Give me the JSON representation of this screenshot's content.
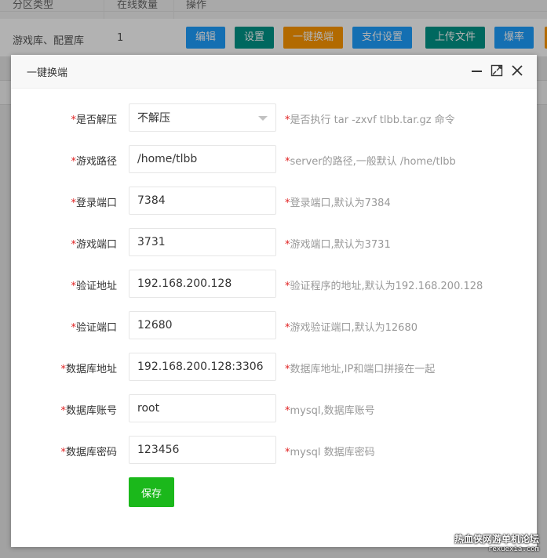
{
  "background_table": {
    "headers": [
      "分区类型",
      "在线数量",
      "操作"
    ],
    "row": {
      "type": "游戏库、配置库",
      "online": "1",
      "actions": [
        {
          "label": "编辑",
          "color": "#1e9fff"
        },
        {
          "label": "设置",
          "color": "#009688"
        },
        {
          "label": "一键换端",
          "color": "#ff9800"
        },
        {
          "label": "支付设置",
          "color": "#1e9fff"
        },
        {
          "label": "上传文件",
          "color": "#009688"
        },
        {
          "label": "爆率",
          "color": "#1e9fff"
        }
      ]
    }
  },
  "modal": {
    "title": "一键换端",
    "controls": [
      "minimize-icon",
      "maximize-icon",
      "close-icon"
    ],
    "fields": [
      {
        "label": "是否解压",
        "type": "select",
        "value": "不解压",
        "hint": "是否执行 tar -zxvf tlbb.tar.gz 命令"
      },
      {
        "label": "游戏路径",
        "type": "text",
        "value": "/home/tlbb",
        "hint": "server的路径,一般默认 /home/tlbb"
      },
      {
        "label": "登录端口",
        "type": "text",
        "value": "7384",
        "hint": "登录端口,默认为7384"
      },
      {
        "label": "游戏端口",
        "type": "text",
        "value": "3731",
        "hint": "游戏端口,默认为3731"
      },
      {
        "label": "验证地址",
        "type": "text",
        "value": "192.168.200.128",
        "hint": "验证程序的地址,默认为192.168.200.128"
      },
      {
        "label": "验证端口",
        "type": "text",
        "value": "12680",
        "hint": "游戏验证端口,默认为12680"
      },
      {
        "label": "数据库地址",
        "type": "text",
        "value": "192.168.200.128:3306",
        "hint": "数据库地址,IP和端口拼接在一起"
      },
      {
        "label": "数据库账号",
        "type": "text",
        "value": "root",
        "hint": "mysql,数据库账号"
      },
      {
        "label": "数据库密码",
        "type": "text",
        "value": "123456",
        "hint": "mysql 数据库密码"
      }
    ],
    "required_mark": "*",
    "save_label": "保存"
  },
  "watermark": {
    "line1": "热血侠网游单机论坛",
    "line2": "rexuexia.com"
  }
}
